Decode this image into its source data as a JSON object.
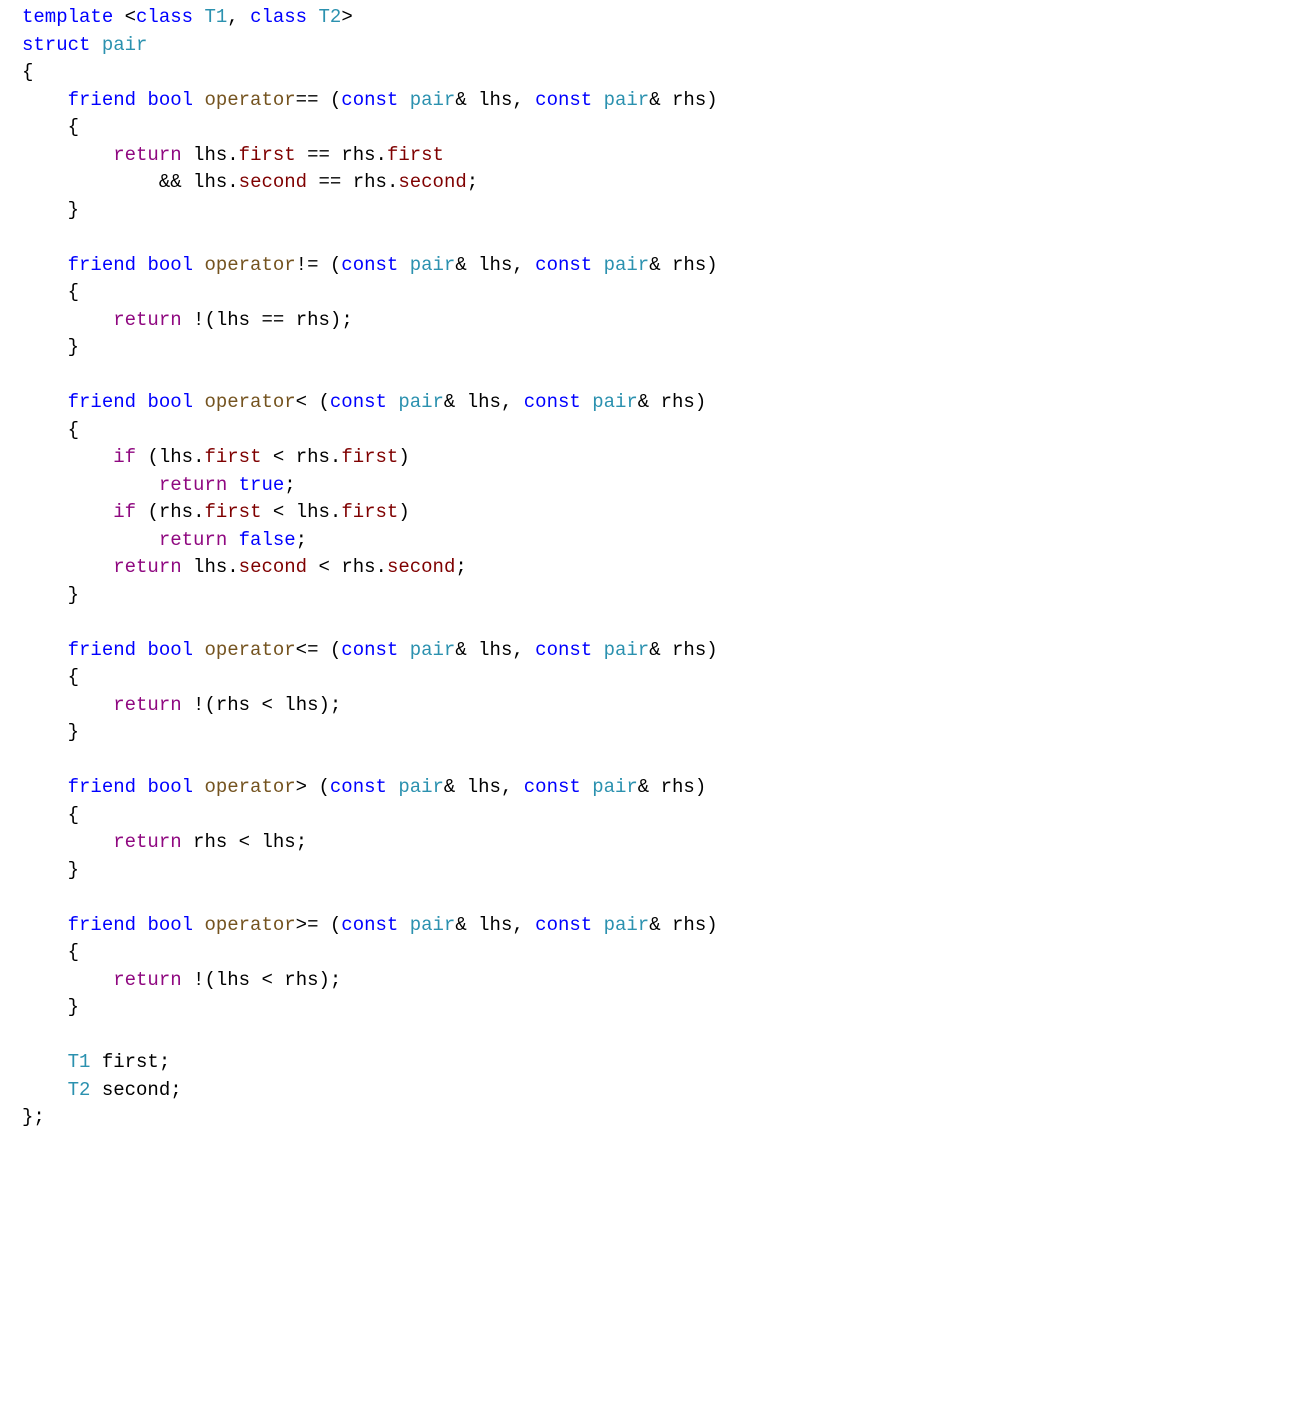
{
  "colors": {
    "keyword": "#0000ff",
    "control": "#8f0880",
    "type": "#2b91af",
    "func": "#74531f",
    "member": "#7f0000"
  },
  "t": {
    "template": "template",
    "class": "class",
    "struct": "struct",
    "friend": "friend",
    "bool": "bool",
    "const": "const",
    "return": "return",
    "if": "if",
    "true": "true",
    "false": "false",
    "pair": "pair",
    "T1": "T1",
    "T2": "T2",
    "lhs": "lhs",
    "rhs": "rhs",
    "first": "first",
    "second": "second",
    "op_eq": "operator",
    "op_ne": "operator",
    "op_lt": "operator",
    "op_le": "operator",
    "op_gt": "operator",
    "op_ge": "operator",
    "sym_eq": "==",
    "sym_ne": "!=",
    "sym_lt": "<",
    "sym_le": "<=",
    "sym_gt": ">",
    "sym_ge": ">="
  }
}
